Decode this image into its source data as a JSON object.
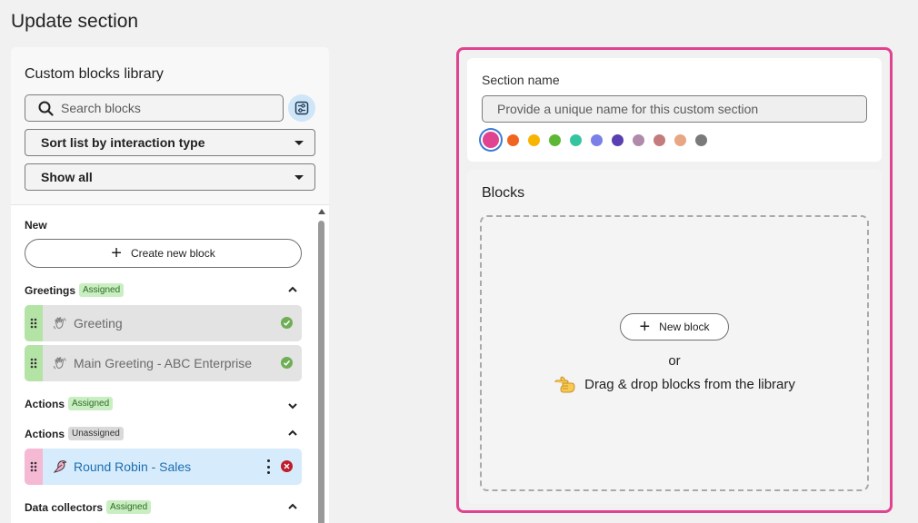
{
  "page": {
    "title": "Update section"
  },
  "library": {
    "title": "Custom blocks library",
    "search_placeholder": "Search blocks",
    "sort_select": "Sort list by interaction type",
    "filter_select": "Show all",
    "groups": {
      "new": {
        "label": "New",
        "create_label": "Create new block"
      },
      "greetings": {
        "label": "Greetings",
        "badge": "Assigned",
        "items": [
          {
            "label": "Greeting"
          },
          {
            "label": "Main Greeting - ABC Enterprise"
          }
        ]
      },
      "actions_assigned": {
        "label": "Actions",
        "badge": "Assigned"
      },
      "actions_unassigned": {
        "label": "Actions",
        "badge": "Unassigned",
        "items": [
          {
            "label": "Round Robin - Sales"
          }
        ]
      },
      "data_collectors": {
        "label": "Data collectors",
        "badge": "Assigned"
      }
    }
  },
  "section": {
    "name_label": "Section name",
    "name_placeholder": "Provide a unique name for this custom section",
    "colors": [
      "#e0438f",
      "#f06420",
      "#f7b500",
      "#5cb834",
      "#35c4a0",
      "#7b7fe8",
      "#5a3fb0",
      "#b08aaa",
      "#c27c7c",
      "#e8a684",
      "#7a7a7a"
    ],
    "selected_color": "#e0438f",
    "blocks_title": "Blocks",
    "new_block_label": "New block",
    "or_text": "or",
    "drag_hint": "Drag & drop blocks from the library"
  },
  "colors": {
    "accent": "#e0438f",
    "selected_item_bg": "#d6ebfb",
    "assigned_badge": "#c9eec2",
    "status_ok": "#6fae55",
    "status_error": "#c01c2b"
  }
}
